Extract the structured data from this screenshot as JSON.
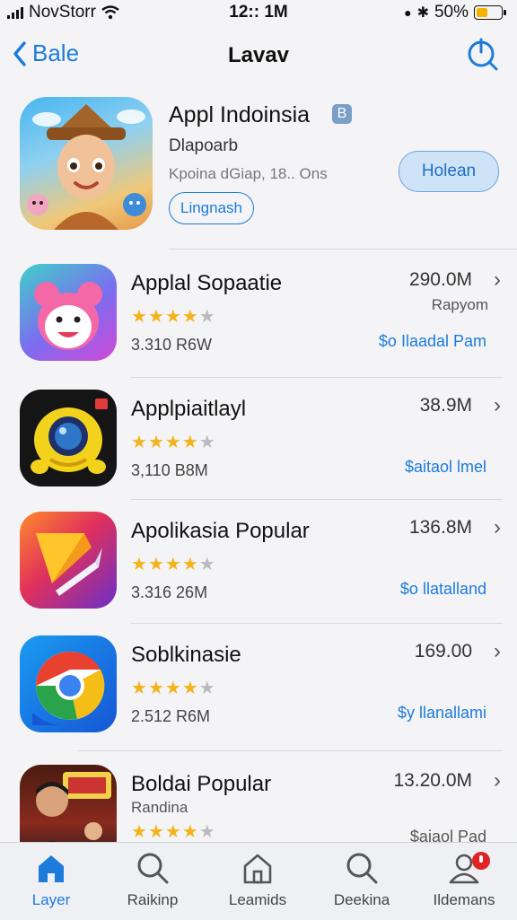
{
  "status_bar": {
    "carrier": "NovStorr",
    "time": "12:: 1M",
    "battery": "50%",
    "battery_level": 0.5
  },
  "nav": {
    "back_label": "Bale",
    "title": "Lavav"
  },
  "featured": {
    "title": "Appl Indoinsia",
    "badge": "B",
    "subtitle": "Dlapoarb",
    "meta": "Kpoina dGiap, 18.. Ons",
    "tag": "Lingnash",
    "button": "Holean"
  },
  "apps": [
    {
      "title": "Applal Sopaatie",
      "rating": 4.5,
      "count": "3.310 R6W",
      "size": "290.0M",
      "extra": "Rapyom",
      "price": "$o Ilaadal Pam"
    },
    {
      "title": "Applpiaitlayl",
      "rating": 4.5,
      "count": "3,110 B8M",
      "size": "38.9M",
      "price": "$aitaol lmel"
    },
    {
      "title": "Apolikasia Popular",
      "rating": 4.5,
      "count": "3.316 26M",
      "size": "136.8M",
      "price": "$o llatalland"
    },
    {
      "title": "Soblkinasie",
      "rating": 4.5,
      "count": "2.512 R6M",
      "size": "169.00",
      "price": "$y llanallami"
    },
    {
      "title": "Boldai Popular",
      "subtitle": "Randina",
      "rating": 4.5,
      "size": "13.20.0M",
      "price": "$aiaol Pad"
    }
  ],
  "tabs": [
    {
      "label": "Layer",
      "icon": "home-icon",
      "active": true
    },
    {
      "label": "Raikinp",
      "icon": "search-icon"
    },
    {
      "label": "Leamids",
      "icon": "house-icon"
    },
    {
      "label": "Deekina",
      "icon": "search-icon"
    },
    {
      "label": "Ildemans",
      "icon": "person-icon",
      "badge": true
    }
  ]
}
